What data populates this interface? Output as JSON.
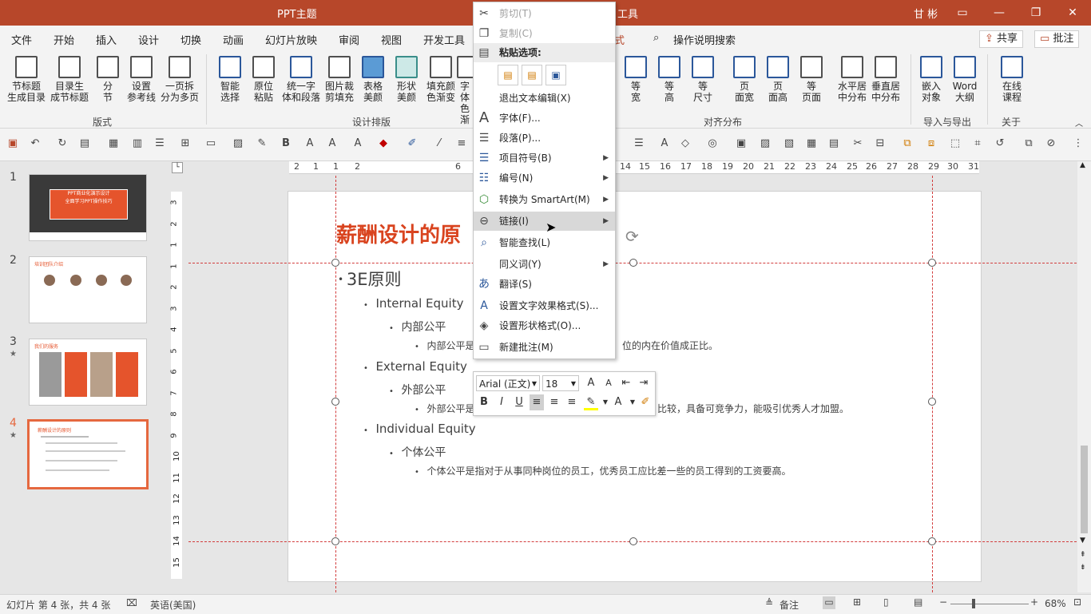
{
  "app": {
    "title": "PPT主题",
    "tools_tab": "工具",
    "user": "甘 彬",
    "window_controls": [
      "▭",
      "—",
      "❐",
      "✕"
    ]
  },
  "tabs": [
    "文件",
    "开始",
    "插入",
    "设计",
    "切换",
    "动画",
    "幻灯片放映",
    "审阅",
    "视图",
    "开发工具",
    "式"
  ],
  "search": {
    "label": "操作说明搜索"
  },
  "share_button": "共享",
  "comment_button": "批注",
  "ribbon": {
    "buttons": [
      {
        "label": "节标题\n生成目录"
      },
      {
        "label": "目录生\n成节标题"
      },
      {
        "label": "分\n节"
      },
      {
        "label": "设置\n参考线"
      },
      {
        "label": "一页拆\n分为多页"
      },
      {
        "label": "智能\n选择"
      },
      {
        "label": "原位\n粘贴"
      },
      {
        "label": "统一字\n体和段落"
      },
      {
        "label": "图片裁\n剪填充"
      },
      {
        "label": "表格\n美颜"
      },
      {
        "label": "形状\n美颜"
      },
      {
        "label": "填充颜\n色渐变"
      },
      {
        "label": "字体\n色渐"
      },
      {
        "label": "等\n宽"
      },
      {
        "label": "等\n高"
      },
      {
        "label": "等\n尺寸"
      },
      {
        "label": "页\n面宽"
      },
      {
        "label": "页\n面高"
      },
      {
        "label": "等\n页面"
      },
      {
        "label": "水平居\n中分布"
      },
      {
        "label": "垂直居\n中分布"
      },
      {
        "label": "嵌入\n对象"
      },
      {
        "label": "Word\n大纲"
      },
      {
        "label": "在线\n课程"
      }
    ],
    "groups": [
      "版式",
      "设计排版",
      "对齐分布",
      "导入与导出",
      "关于"
    ]
  },
  "thumbnails": [
    {
      "num": "1",
      "star": "",
      "title": "PPT商业化演示设计",
      "subtitle": "全面学习PPT操作技巧"
    },
    {
      "num": "2",
      "star": "",
      "title": "培训团队介绍",
      "subtitle": ""
    },
    {
      "num": "3",
      "star": "★",
      "title": "我们的服务",
      "subtitle": ""
    },
    {
      "num": "4",
      "star": "★",
      "title": "薪酬设计的原则",
      "subtitle": ""
    }
  ],
  "ruler": {
    "h": [
      "2",
      "1",
      "1",
      "2",
      "6",
      "14",
      "15",
      "16",
      "17",
      "18",
      "19",
      "20",
      "21",
      "22",
      "23",
      "24",
      "25",
      "26",
      "27",
      "28",
      "29",
      "30",
      "31"
    ],
    "v": [
      "3",
      "2",
      "1",
      "1",
      "2",
      "3",
      "4",
      "5",
      "6",
      "7",
      "8",
      "9",
      "10",
      "11",
      "12",
      "13",
      "14",
      "15"
    ]
  },
  "slide": {
    "title": "薪酬设计的原",
    "l1": "3E原则",
    "items": [
      {
        "h": "Internal Equity",
        "sub": "内部公平",
        "detail": "内部公平是",
        "detail_tail": "位的内在价值成正比。"
      },
      {
        "h": "External Equity",
        "sub": "外部公平",
        "detail": "外部公平是",
        "detail_tail": "比较，具备可竞争力，能吸引优秀人才加盟。"
      },
      {
        "h": "Individual Equity",
        "sub": "个体公平",
        "detail": "个体公平是指对于从事同种岗位的员工，优秀员工应比差一些的员工得到的工资要高。",
        "detail_tail": ""
      }
    ]
  },
  "context_menu": {
    "items": [
      {
        "label": "剪切(T)",
        "icon": "scissors-icon",
        "disabled": true
      },
      {
        "label": "复制(C)",
        "icon": "copy-icon",
        "disabled": true
      },
      {
        "label": "粘贴选项:",
        "icon": "paste-icon",
        "header": true
      },
      {
        "label": "退出文本编辑(X)",
        "icon": ""
      },
      {
        "label": "字体(F)...",
        "icon": "font-icon"
      },
      {
        "label": "段落(P)...",
        "icon": "paragraph-icon"
      },
      {
        "label": "项目符号(B)",
        "icon": "bullets-icon",
        "sub": true
      },
      {
        "label": "编号(N)",
        "icon": "numbering-icon",
        "sub": true
      },
      {
        "label": "转换为 SmartArt(M)",
        "icon": "smartart-icon",
        "sub": true
      },
      {
        "label": "链接(I)",
        "icon": "link-icon",
        "sub": true,
        "highlight": true
      },
      {
        "label": "智能查找(L)",
        "icon": "smart-lookup-icon"
      },
      {
        "label": "同义词(Y)",
        "icon": "",
        "sub": true
      },
      {
        "label": "翻译(S)",
        "icon": "translate-icon"
      },
      {
        "label": "设置文字效果格式(S)...",
        "icon": "text-effects-icon"
      },
      {
        "label": "设置形状格式(O)...",
        "icon": "shape-format-icon"
      },
      {
        "label": "新建批注(M)",
        "icon": "new-comment-icon"
      }
    ]
  },
  "mini_toolbar": {
    "font": "Arial (正文)",
    "size": "18"
  },
  "status": {
    "slide_info": "幻灯片 第 4 张，共 4 张",
    "language": "英语(美国)",
    "notes": "备注",
    "zoom": "68%"
  }
}
